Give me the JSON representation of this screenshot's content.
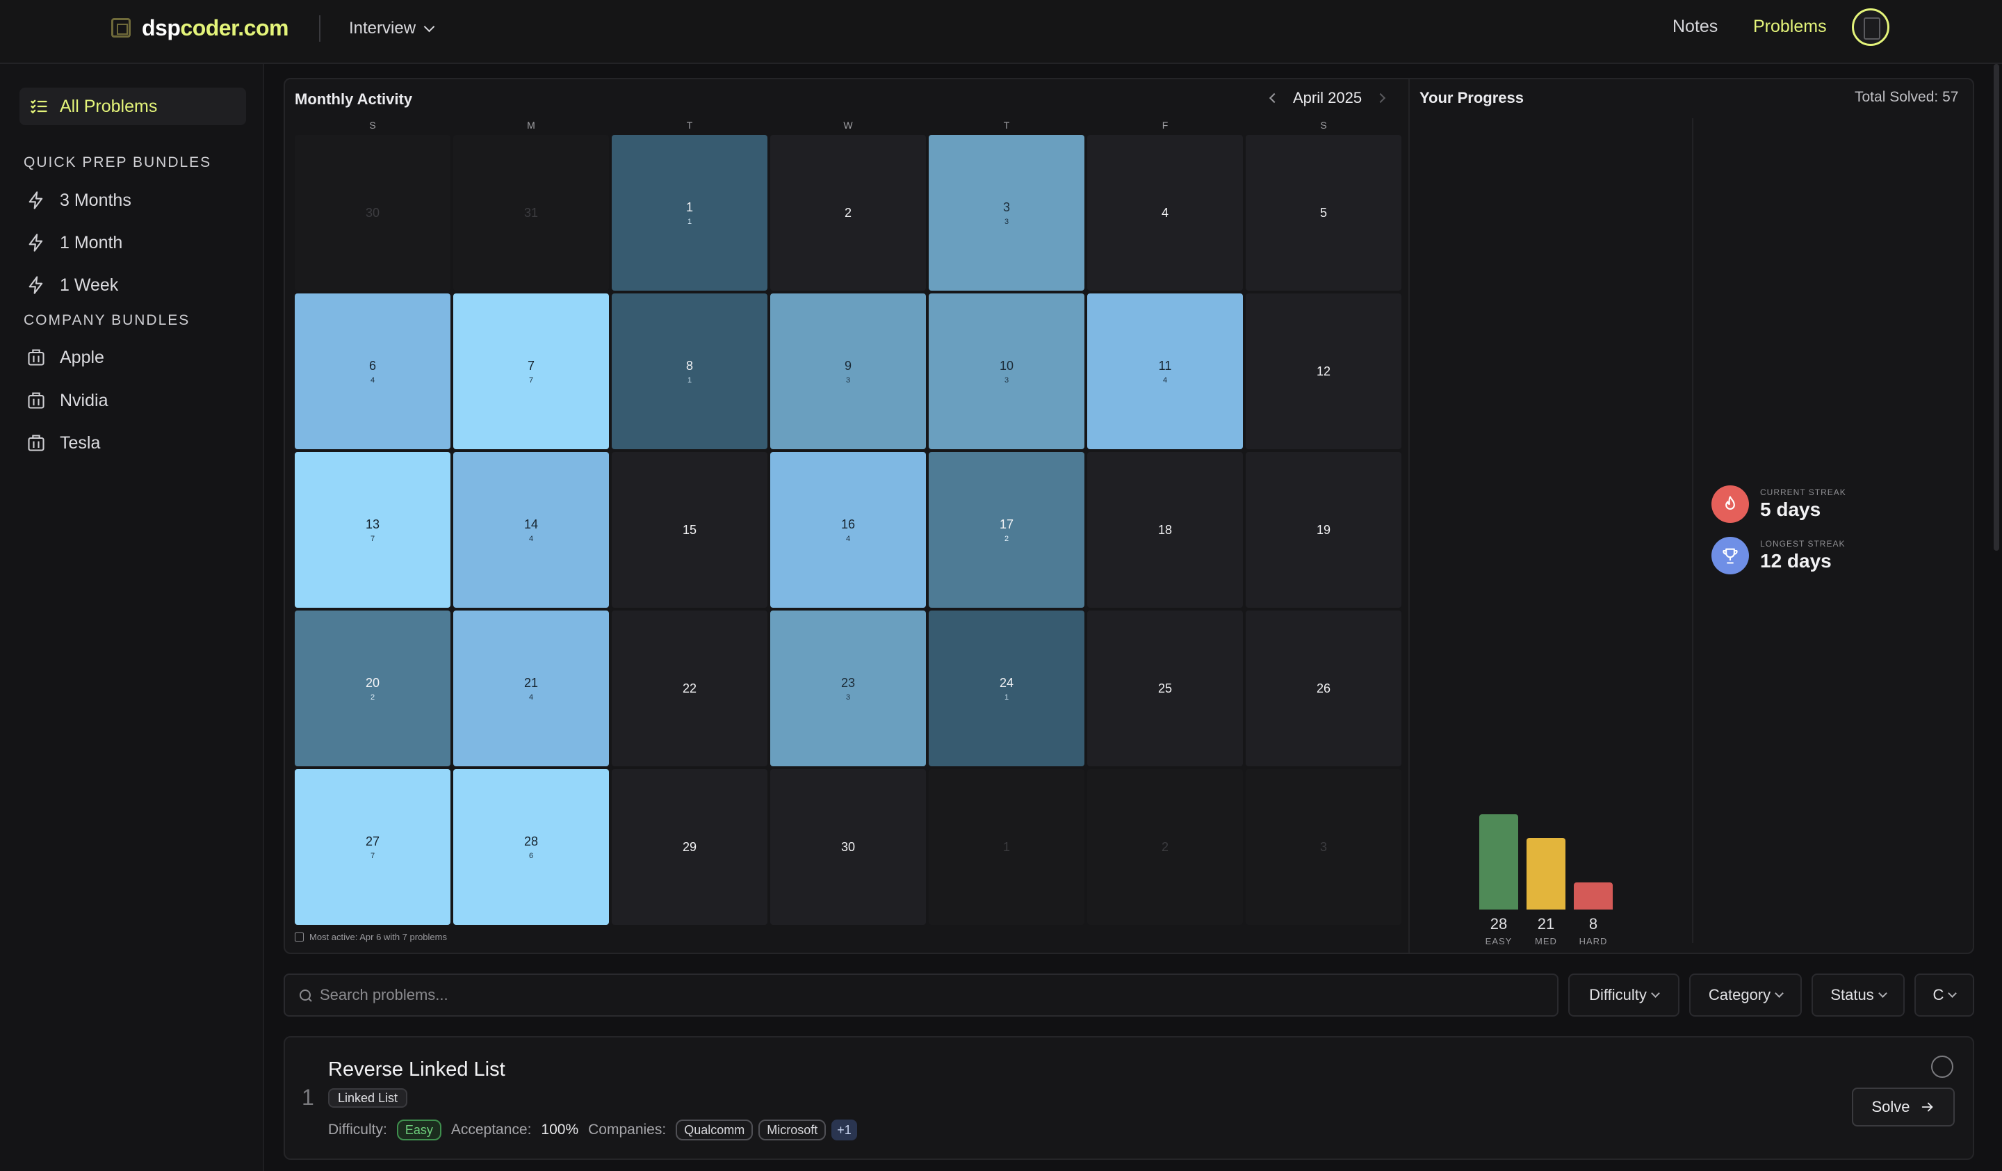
{
  "brand": {
    "part1": "dsp",
    "part2": "coder.com"
  },
  "header": {
    "mode": "Interview",
    "nav": {
      "notes": "Notes",
      "problems": "Problems"
    }
  },
  "sidebar": {
    "all_problems": "All Problems",
    "quick_prep_heading": "QUICK PREP BUNDLES",
    "quick_prep": [
      "3 Months",
      "1 Month",
      "1 Week"
    ],
    "company_heading": "COMPANY BUNDLES",
    "companies": [
      "Apple",
      "Nvidia",
      "Tesla"
    ]
  },
  "calendar": {
    "title": "Monthly Activity",
    "month": "April 2025",
    "weekdays": [
      "S",
      "M",
      "T",
      "W",
      "T",
      "F",
      "S"
    ],
    "days": [
      {
        "d": "30",
        "c": "",
        "lvl": "dim"
      },
      {
        "d": "31",
        "c": "",
        "lvl": "dim"
      },
      {
        "d": "1",
        "c": "1",
        "lvl": "l1"
      },
      {
        "d": "2",
        "c": "",
        "lvl": "none"
      },
      {
        "d": "3",
        "c": "3",
        "lvl": "l3"
      },
      {
        "d": "4",
        "c": "",
        "lvl": "none"
      },
      {
        "d": "5",
        "c": "",
        "lvl": "none"
      },
      {
        "d": "6",
        "c": "4",
        "lvl": "l4"
      },
      {
        "d": "7",
        "c": "7",
        "lvl": "l5"
      },
      {
        "d": "8",
        "c": "1",
        "lvl": "l1"
      },
      {
        "d": "9",
        "c": "3",
        "lvl": "l3"
      },
      {
        "d": "10",
        "c": "3",
        "lvl": "l3"
      },
      {
        "d": "11",
        "c": "4",
        "lvl": "l4"
      },
      {
        "d": "12",
        "c": "",
        "lvl": "none"
      },
      {
        "d": "13",
        "c": "7",
        "lvl": "l5"
      },
      {
        "d": "14",
        "c": "4",
        "lvl": "l4"
      },
      {
        "d": "15",
        "c": "",
        "lvl": "none"
      },
      {
        "d": "16",
        "c": "4",
        "lvl": "l4"
      },
      {
        "d": "17",
        "c": "2",
        "lvl": "l2"
      },
      {
        "d": "18",
        "c": "",
        "lvl": "none"
      },
      {
        "d": "19",
        "c": "",
        "lvl": "none"
      },
      {
        "d": "20",
        "c": "2",
        "lvl": "l2"
      },
      {
        "d": "21",
        "c": "4",
        "lvl": "l4"
      },
      {
        "d": "22",
        "c": "",
        "lvl": "none"
      },
      {
        "d": "23",
        "c": "3",
        "lvl": "l3"
      },
      {
        "d": "24",
        "c": "1",
        "lvl": "l1"
      },
      {
        "d": "25",
        "c": "",
        "lvl": "none"
      },
      {
        "d": "26",
        "c": "",
        "lvl": "none"
      },
      {
        "d": "27",
        "c": "7",
        "lvl": "l5"
      },
      {
        "d": "28",
        "c": "6",
        "lvl": "l5"
      },
      {
        "d": "29",
        "c": "",
        "lvl": "none"
      },
      {
        "d": "30",
        "c": "",
        "lvl": "none"
      },
      {
        "d": "1",
        "c": "",
        "lvl": "dim"
      },
      {
        "d": "2",
        "c": "",
        "lvl": "dim"
      },
      {
        "d": "3",
        "c": "",
        "lvl": "dim"
      }
    ],
    "most_active": "Most active: Apr 6 with 7 problems"
  },
  "progress": {
    "title": "Your Progress",
    "total": "Total Solved: 57",
    "current_streak_label": "CURRENT STREAK",
    "current_streak_value": "5 days",
    "longest_streak_label": "LONGEST STREAK",
    "longest_streak_value": "12 days"
  },
  "chart_data": {
    "type": "bar",
    "categories": [
      "EASY",
      "MED",
      "HARD"
    ],
    "values": [
      28,
      21,
      8
    ],
    "colors": [
      "#4f8a57",
      "#e3b53c",
      "#d45a57"
    ]
  },
  "filters": {
    "search_placeholder": "Search problems...",
    "buttons": [
      "Difficulty",
      "Category",
      "Status",
      "C"
    ]
  },
  "problem": {
    "number": "1",
    "title": "Reverse Linked List",
    "tag": "Linked List",
    "difficulty_label": "Difficulty:",
    "difficulty": "Easy",
    "acceptance_label": "Acceptance:",
    "acceptance": "100%",
    "companies_label": "Companies:",
    "companies": [
      "Qualcomm",
      "Microsoft"
    ],
    "more": "+1",
    "solve": "Solve"
  },
  "colors": {
    "accent": "#e4f47a",
    "streak_current": "#e5605a",
    "streak_longest": "#6f8fe6"
  }
}
